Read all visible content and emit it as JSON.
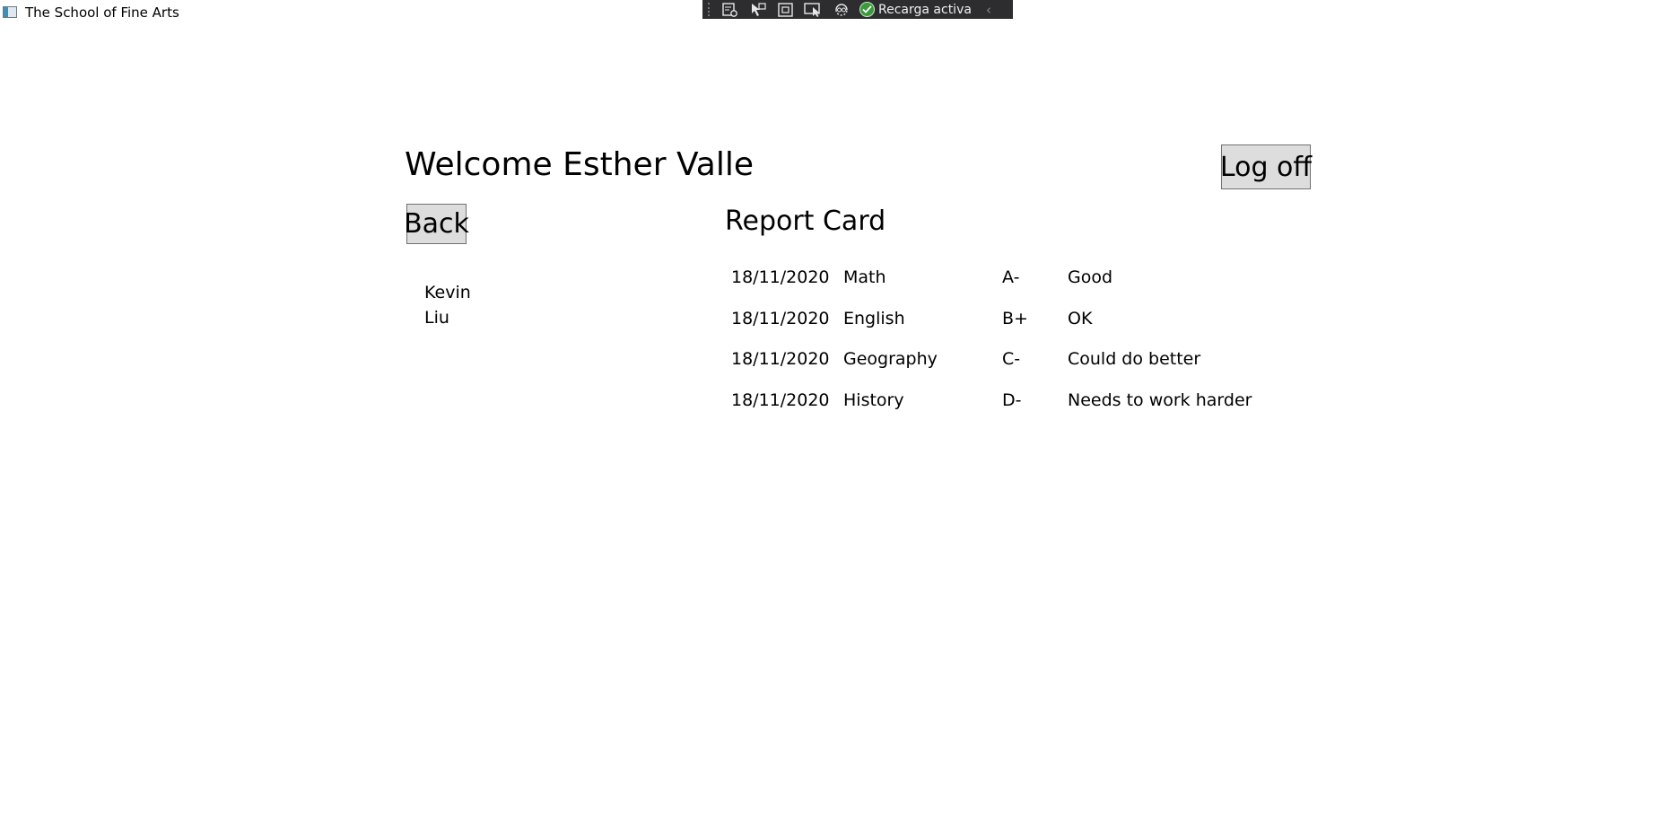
{
  "window": {
    "title": "The School of Fine Arts"
  },
  "debug_toolbar": {
    "tools": [
      {
        "name": "live-visual-tree-icon"
      },
      {
        "name": "select-element-icon"
      },
      {
        "name": "display-layout-adorners-icon"
      },
      {
        "name": "track-focused-element-icon"
      },
      {
        "name": "binding-failures-icon"
      }
    ],
    "status_text": "Recarga activa",
    "status_icon": "check-circle-icon"
  },
  "header": {
    "welcome_text": "Welcome Esther Valle",
    "logoff_label": "Log off"
  },
  "nav": {
    "back_label": "Back"
  },
  "student": {
    "first_name": "Kevin",
    "last_name": "Liu"
  },
  "report_card": {
    "title": "Report Card",
    "rows": [
      {
        "date": "18/11/2020",
        "subject": "Math",
        "grade": "A-",
        "comment": "Good"
      },
      {
        "date": "18/11/2020",
        "subject": "English",
        "grade": "B+",
        "comment": "OK"
      },
      {
        "date": "18/11/2020",
        "subject": "Geography",
        "grade": "C-",
        "comment": "Could do better"
      },
      {
        "date": "18/11/2020",
        "subject": "History",
        "grade": "D-",
        "comment": "Needs to work harder"
      }
    ]
  },
  "colors": {
    "toolbar_bg": "#2d2d30",
    "button_bg": "#dddddd",
    "button_border": "#707070",
    "status_ok": "#3c9a3c"
  }
}
